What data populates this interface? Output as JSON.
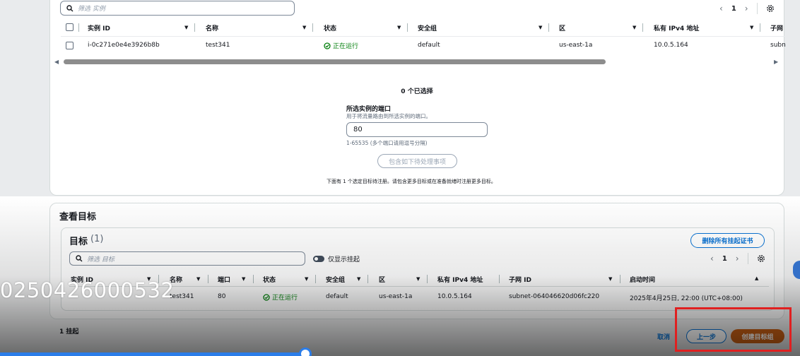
{
  "top_table": {
    "search_placeholder": "筛选 实例",
    "page": "1",
    "headers": [
      "实例 ID",
      "名称",
      "状态",
      "安全组",
      "区",
      "私有 IPv4 地址",
      "子网"
    ],
    "row": {
      "id": "i-0c271e0e4e3926b8b",
      "name": "test341",
      "status": "正在运行",
      "sg": "default",
      "zone": "us-east-1a",
      "ip": "10.0.5.164",
      "subnet": "subn"
    }
  },
  "selection": {
    "count_label": "0 个已选择",
    "port_title": "所选实例的端口",
    "port_desc": "用于将流量路由到所选实例的端口。",
    "port_value": "80",
    "port_hint": "1-65535 (多个端口请用逗号分隔)",
    "include_button": "包含如下待处理事项",
    "info_note": "下面有 1 个选定目标待注册。请包含更多目标或在准备就绪时注册更多目标。"
  },
  "review": {
    "title": "查看目标",
    "targets_label": "目标",
    "targets_count": "(1)",
    "remove_all_button": "删除所有挂起证书",
    "search_placeholder": "筛选 目标",
    "toggle_label": "仅显示挂起",
    "page": "1",
    "headers": [
      "实例 ID",
      "名称",
      "端口",
      "状态",
      "安全组",
      "区",
      "私有 IPv4 地址",
      "子网 ID",
      "启动时间"
    ],
    "row": {
      "name": "test341",
      "port": "80",
      "status": "正在运行",
      "sg": "default",
      "zone": "us-east-1a",
      "ip": "10.0.5.164",
      "subnet": "subnet-064046620d06fc220",
      "launch": "2025年4月25日, 22:00 (UTC+08:00)"
    }
  },
  "footer": {
    "pending": "1 挂起",
    "cancel": "取消",
    "prev": "上一步",
    "create": "创建目标组"
  },
  "watermark": "0250426000532",
  "colors": {
    "primary": "#c75f14",
    "link": "#0972d3",
    "success": "#037f0c",
    "highlight": "#e02020"
  }
}
